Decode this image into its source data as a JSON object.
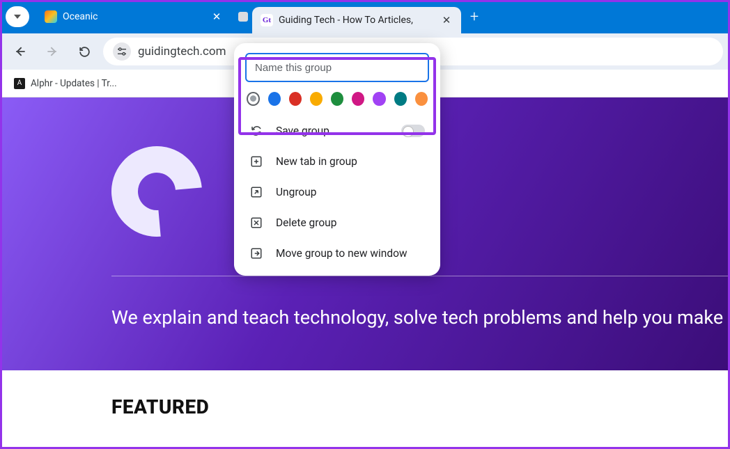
{
  "tabs": {
    "inactive": {
      "title": "Oceanic"
    },
    "active": {
      "title": "Guiding Tech - How To Articles,"
    }
  },
  "toolbar": {
    "url": "guidingtech.com"
  },
  "bookmarks": {
    "item1": "Alphr - Updates | Tr..."
  },
  "group_popup": {
    "name_placeholder": "Name this group",
    "colors": [
      "#9aa0a6",
      "#1a73e8",
      "#d93025",
      "#f9ab00",
      "#1e8e3e",
      "#d01884",
      "#a142f4",
      "#007b83",
      "#fa903e"
    ],
    "menu": {
      "save": "Save group",
      "new_tab": "New tab in group",
      "ungroup": "Ungroup",
      "delete": "Delete group",
      "move": "Move group to new window"
    }
  },
  "page": {
    "tagline": "We explain and teach technology, solve tech problems and help you make gadge",
    "featured": "FEATURED"
  }
}
